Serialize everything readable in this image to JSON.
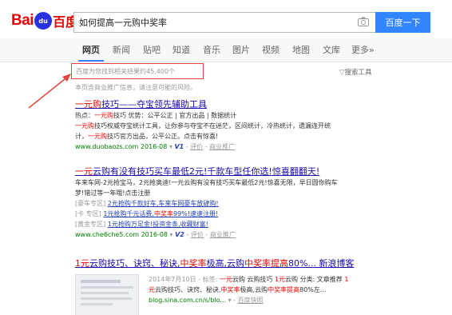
{
  "header": {
    "logo_left": "Bai",
    "logo_paw": "du",
    "logo_right": "百度",
    "query": "如何提高一元购中奖率",
    "search_button": "百度一下"
  },
  "tabs": [
    "网页",
    "新闻",
    "贴吧",
    "知道",
    "音乐",
    "图片",
    "视频",
    "地图",
    "文库",
    "更多»"
  ],
  "results_info": {
    "count": "百度为您找到相关结果约45,400个",
    "tools": "搜索工具",
    "notice": "本页含商业推广信息，请注意可能的风险。"
  },
  "result1": {
    "title_a": "一元购",
    "title_b": "技巧——夺宝领先辅助工具",
    "line1_a": "热点：",
    "line1_b": "一元购",
    "line1_c": "技巧    优势：公平公正 | 官方出品 | 数据统计",
    "line2_a": "一元购",
    "line2_b": "技巧权威夺宝统计工具，让你参与夺宝不在迷茫，区间统计，冷热统计，遗漏连开统",
    "line3": "计，",
    "line3_b": "一元购",
    "line3_c": "技巧官方出品，公平公正。点击有惊喜!",
    "url": "www.duobaozs.com  2016-08",
    "v": "V1",
    "eval": "评价",
    "ad": "商业推广"
  },
  "result2": {
    "title_a": "一元",
    "title_b": "云购有没有技巧买车最低2元!千款车型任你选!惊喜翻翻天!",
    "line1": "车来车网-2元抢宝马，2元抢奥迪!一元云购有没有技巧买车最低2元!惊喜无限，早日圆你购车",
    "line2": "梦!错过等一年哦!点击注册",
    "sub1_tag": "[豪车专区]",
    "sub1_link": "2元抢购千款好车,车来车网豪车放肆购!",
    "sub2_tag": "[卡 专区]",
    "sub2_link_a": "1元抢购千元话费,",
    "sub2_link_b": "中奖率",
    "sub2_link_c": "99%!速速注册!",
    "sub3_tag": "[黄金专区]",
    "sub3_link": "1元抢购万足金!投资金条,收藏财富!",
    "url": "www.che6che5.com  2016-08",
    "v": "V2",
    "eval": "评价",
    "ad": "商业推广"
  },
  "result3": {
    "title_a": "1元",
    "title_b": "云购技巧、诀窍、秘诀,",
    "title_c": "中奖率",
    "title_d": "极高,云购",
    "title_e": "中奖率提高",
    "title_f": "80%... 新浪博客",
    "line1_a": "2014年7月10日 - 标签: ",
    "line1_b": "一元",
    "line1_c": "云购 云购技巧 ",
    "line1_d": "1元",
    "line1_e": "云购 分类: 文章推荐 ",
    "line1_f": "1",
    "line2_a": "元",
    "line2_b": "云购技巧、诀窍、秘诀,",
    "line2_c": "中奖率",
    "line2_d": "极高,云购",
    "line2_e": "中奖率提高",
    "line2_f": "80%左...",
    "url": "blog.sina.com.cn/s/blo...",
    "cache": "百度快照"
  }
}
